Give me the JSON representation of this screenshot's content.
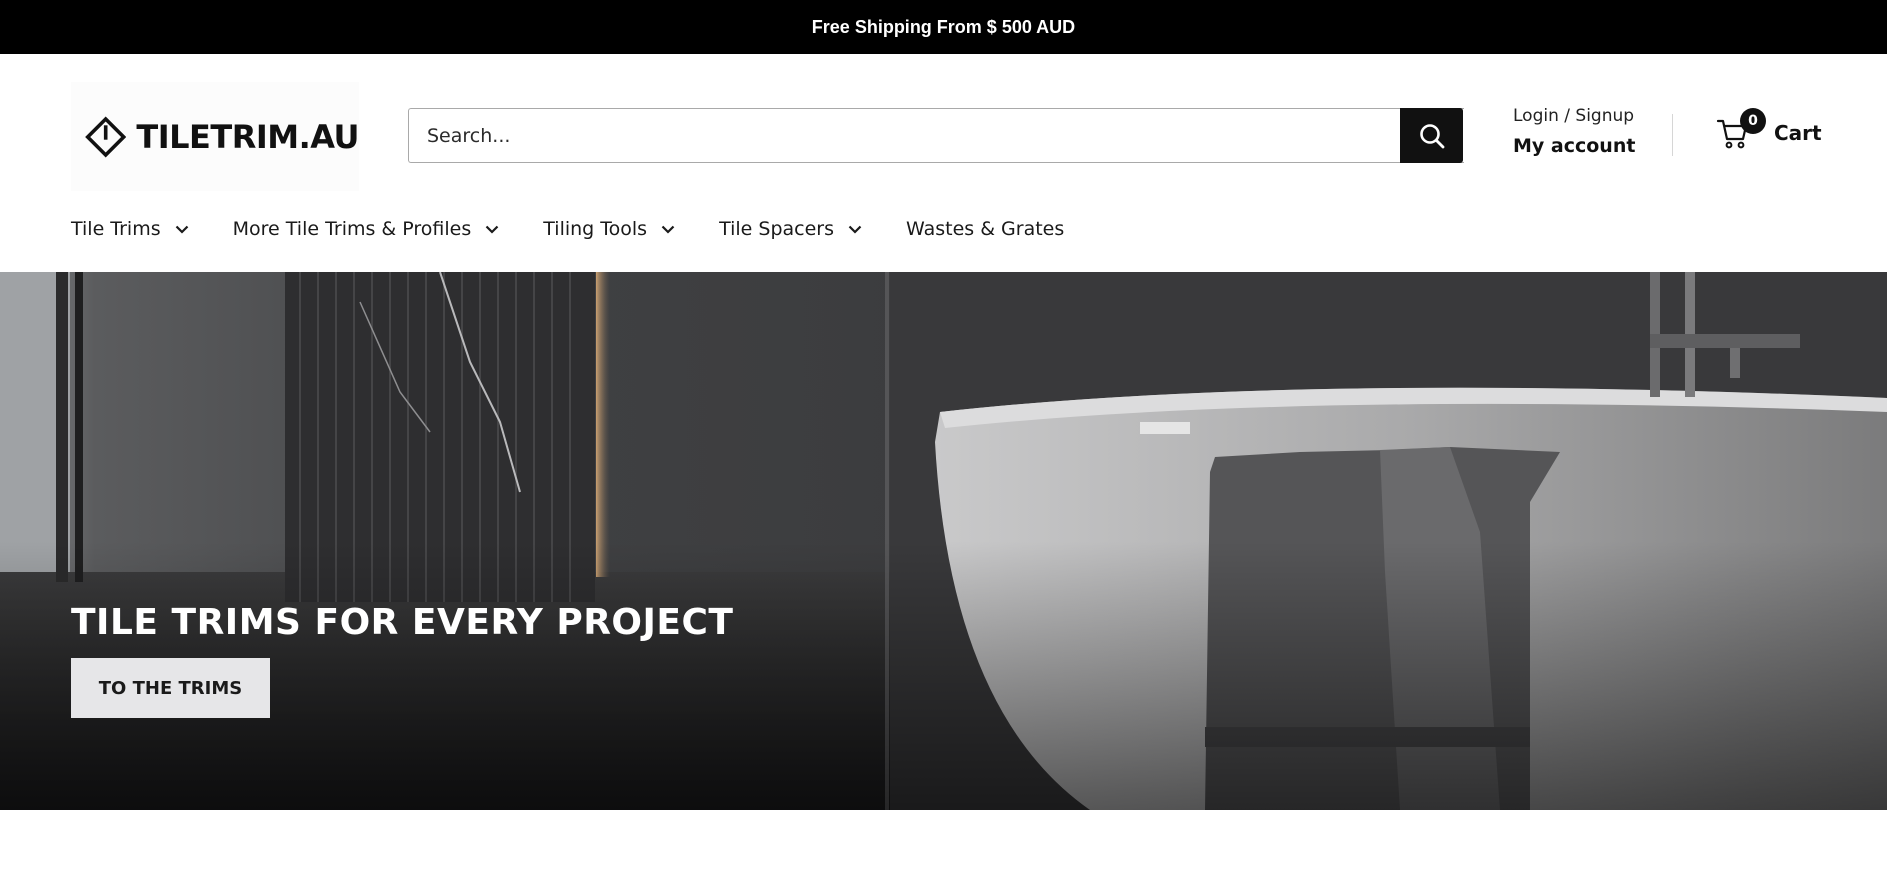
{
  "announcement": {
    "text": "Free Shipping From $ 500 AUD"
  },
  "header": {
    "logo_text": "TILETRIM.AU",
    "search_placeholder": "Search...",
    "account": {
      "login_label": "Login / Signup",
      "my_account_label": "My account"
    },
    "cart": {
      "count": "0",
      "label": "Cart"
    }
  },
  "nav": {
    "items": [
      {
        "label": "Tile Trims",
        "has_dropdown": true
      },
      {
        "label": "More Tile Trims & Profiles",
        "has_dropdown": true
      },
      {
        "label": "Tiling Tools",
        "has_dropdown": true
      },
      {
        "label": "Tile Spacers",
        "has_dropdown": true
      },
      {
        "label": "Wastes & Grates",
        "has_dropdown": false
      }
    ]
  },
  "hero": {
    "title": "TILE TRIMS FOR EVERY PROJECT",
    "button_label": "TO THE TRIMS"
  },
  "icons": [
    "diamond-logo-icon",
    "search-icon",
    "cart-icon",
    "chevron-down-icon"
  ],
  "colors": {
    "announcement_bg": "#000000",
    "accent": "#111111",
    "button_bg": "#e6e6e8"
  }
}
